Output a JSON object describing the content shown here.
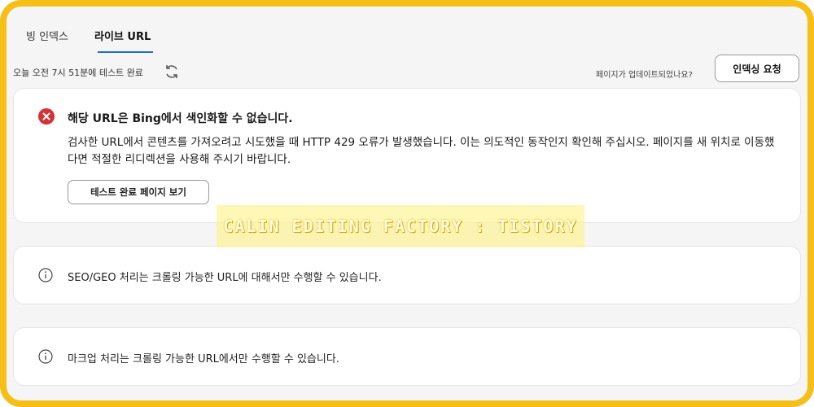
{
  "tabs": [
    {
      "label": "빙 인덱스"
    },
    {
      "label": "라이브 URL"
    }
  ],
  "status": {
    "test_time": "오늘 오전 7시 51분에 테스트 완료",
    "updated_question": "페이지가 업데이트되었나요?",
    "request_indexing_label": "인덱싱 요청"
  },
  "error_card": {
    "title": "해당 URL은 Bing에서 색인화할 수 없습니다.",
    "body": "검사한 URL에서 콘텐츠를 가져오려고 시도했을 때 HTTP 429 오류가 발생했습니다. 이는 의도적인 동작인지 확인해 주십시오. 페이지를 새 위치로 이동했다면 적절한 리디렉션을 사용해 주시기 바랍니다.",
    "button_label": "테스트 완료 페이지 보기"
  },
  "info_cards": [
    {
      "text": "SEO/GEO 처리는 크롤링 가능한 URL에 대해서만 수행할 수 있습니다."
    },
    {
      "text": "마크업 처리는 크롤링 가능한 URL에서만 수행할 수 있습니다."
    }
  ],
  "watermark": "CALIN EDITING FACTORY : TISTORY",
  "colors": {
    "frame": "#f5bf17",
    "accent": "#1f6fc7",
    "error": "#d13438"
  }
}
